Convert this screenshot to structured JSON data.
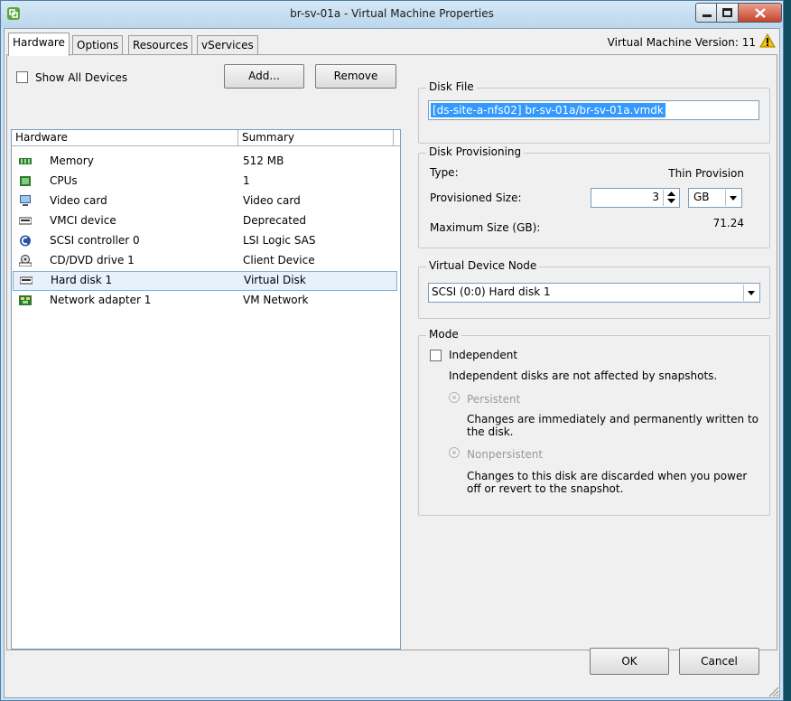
{
  "window": {
    "title": "br-sv-01a - Virtual Machine Properties"
  },
  "tabs": [
    {
      "label": "Hardware",
      "active": true
    },
    {
      "label": "Options",
      "active": false
    },
    {
      "label": "Resources",
      "active": false
    },
    {
      "label": "vServices",
      "active": false
    }
  ],
  "vm_version": "Virtual Machine Version: 11",
  "hardware_panel": {
    "show_all_devices_label": "Show All Devices",
    "show_all_devices_checked": false,
    "add_button": "Add...",
    "remove_button": "Remove",
    "columns": [
      "Hardware",
      "Summary"
    ],
    "devices": [
      {
        "name": "Memory",
        "summary": "512 MB",
        "icon": "memory-icon"
      },
      {
        "name": "CPUs",
        "summary": "1",
        "icon": "cpu-icon"
      },
      {
        "name": "Video card",
        "summary": "Video card",
        "icon": "monitor-icon"
      },
      {
        "name": "VMCI device",
        "summary": "Deprecated",
        "icon": "device-icon"
      },
      {
        "name": "SCSI controller 0",
        "summary": "LSI Logic SAS",
        "icon": "scsi-controller-icon"
      },
      {
        "name": "CD/DVD drive 1",
        "summary": "Client Device",
        "icon": "cd-drive-icon"
      },
      {
        "name": "Hard disk 1",
        "summary": "Virtual Disk",
        "icon": "hard-disk-icon",
        "selected": true
      },
      {
        "name": "Network adapter 1",
        "summary": "VM Network",
        "icon": "network-adapter-icon"
      }
    ]
  },
  "disk_file": {
    "group_title": "Disk File",
    "value": "[ds-site-a-nfs02] br-sv-01a/br-sv-01a.vmdk"
  },
  "disk_provisioning": {
    "group_title": "Disk Provisioning",
    "type_label": "Type:",
    "type_value": "Thin Provision",
    "provisioned_label": "Provisioned Size:",
    "provisioned_value": "3",
    "unit_value": "GB",
    "max_label": "Maximum Size (GB):",
    "max_value": "71.24"
  },
  "virtual_device_node": {
    "group_title": "Virtual Device Node",
    "value": "SCSI (0:0) Hard disk 1"
  },
  "mode": {
    "group_title": "Mode",
    "independent_label": "Independent",
    "independent_checked": false,
    "independent_desc": "Independent disks are not affected by snapshots.",
    "persistent_label": "Persistent",
    "persistent_desc_line1": "Changes are immediately and permanently written to",
    "persistent_desc_line2": "the disk.",
    "nonpersistent_label": "Nonpersistent",
    "nonpersistent_desc_line1": "Changes to this disk are discarded when you power",
    "nonpersistent_desc_line2": "off or revert to the snapshot."
  },
  "footer": {
    "ok_button": "OK",
    "cancel_button": "Cancel"
  },
  "colors": {
    "selection": "#3399ff",
    "selected_row": "#e6f1fb",
    "title_bar": "#cfe3f2"
  }
}
